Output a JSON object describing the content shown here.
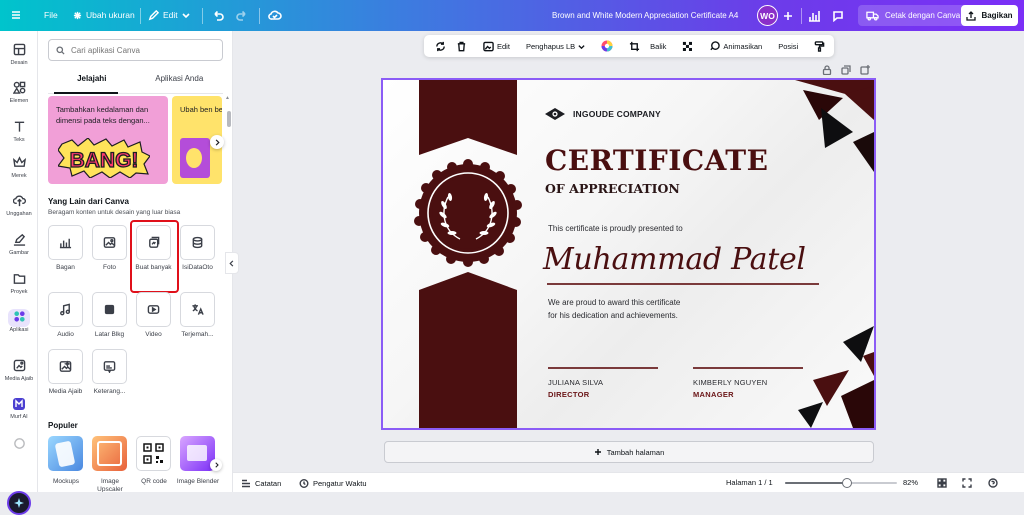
{
  "topbar": {
    "file": "File",
    "resize": "Ubah ukuran",
    "edit": "Edit",
    "doc_title": "Brown and White Modern Appreciation Certificate A4",
    "avatar_initials": "WO",
    "print": "Cetak dengan Canva",
    "share": "Bagikan"
  },
  "rail": {
    "items": [
      {
        "label": "Desain",
        "icon": "layout-icon"
      },
      {
        "label": "Elemen",
        "icon": "shapes-icon"
      },
      {
        "label": "Teks",
        "icon": "text-icon"
      },
      {
        "label": "Merek",
        "icon": "crown-icon"
      },
      {
        "label": "Unggahan",
        "icon": "upload-icon"
      },
      {
        "label": "Gambar",
        "icon": "pen-icon"
      },
      {
        "label": "Proyek",
        "icon": "folder-icon"
      },
      {
        "label": "Aplikasi",
        "icon": "apps-icon"
      },
      {
        "label": "Media Ajaib",
        "icon": "magic-media-icon"
      },
      {
        "label": "Murf AI",
        "icon": "murf-icon"
      }
    ]
  },
  "panel": {
    "search_placeholder": "Cari aplikasi Canva",
    "tabs": [
      "Jelajahi",
      "Aplikasi Anda"
    ],
    "banner1_text": "Tambahkan kedalaman dan dimensi pada teks dengan...",
    "banner1_art": "BANG!",
    "banner2_text": "Ubah ben bebas de",
    "section1_title": "Yang Lain dari Canva",
    "section1_sub": "Beragam konten untuk desain yang luar biasa",
    "apps_row1": [
      {
        "label": "Bagan",
        "icon": "chart-icon"
      },
      {
        "label": "Foto",
        "icon": "photo-icon"
      },
      {
        "label": "Buat banyak",
        "icon": "bulk-create-icon"
      },
      {
        "label": "IsiDataOto",
        "icon": "database-icon"
      }
    ],
    "apps_row2": [
      {
        "label": "Audio",
        "icon": "music-icon"
      },
      {
        "label": "Latar Blkg",
        "icon": "background-icon"
      },
      {
        "label": "Video",
        "icon": "video-icon"
      },
      {
        "label": "Terjemah...",
        "icon": "translate-icon"
      }
    ],
    "apps_row3": [
      {
        "label": "Media Ajaib",
        "icon": "magic-media-icon"
      },
      {
        "label": "Keterang...",
        "icon": "caption-icon"
      }
    ],
    "section2_title": "Populer",
    "popular": [
      {
        "label": "Mockups"
      },
      {
        "label": "Image Upscaler"
      },
      {
        "label": "QR code"
      },
      {
        "label": "Image Blender"
      }
    ]
  },
  "context_toolbar": {
    "edit": "Edit",
    "bg_remover": "Penghapus LB",
    "flip": "Balik",
    "animate": "Animasikan",
    "position": "Posisi"
  },
  "certificate": {
    "company": "INGOUDE COMPANY",
    "title": "CERTIFICATE",
    "subtitle": "OF APPRECIATION",
    "presented": "This certificate is proudly presented to",
    "name": "Muhammad Patel",
    "award_line1": "We are proud to award this certificate",
    "award_line2": "for his dedication and achievements.",
    "sig1_name": "JULIANA SILVA",
    "sig1_role": "DIRECTOR",
    "sig2_name": "KIMBERLY NGUYEN",
    "sig2_role": "MANAGER",
    "accent_color": "#4a0f10"
  },
  "add_page": "Tambah halaman",
  "bottombar": {
    "notes": "Catatan",
    "timer": "Pengatur Waktu",
    "page": "Halaman 1 / 1",
    "zoom": "82%",
    "zoom_fraction": 0.55
  }
}
